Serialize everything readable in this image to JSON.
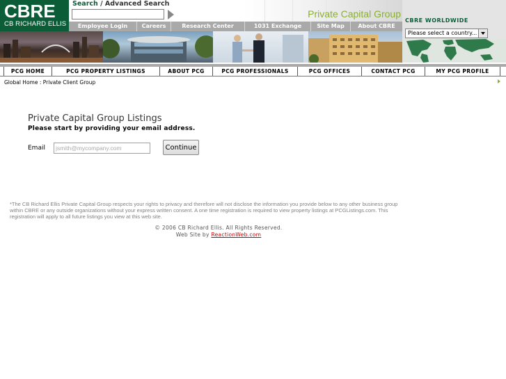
{
  "logo": {
    "main": "CBRE",
    "sub": "CB RICHARD ELLIS"
  },
  "search": {
    "search_label": "Search",
    "separator": "/",
    "advanced_label": "Advanced Search",
    "input_value": "",
    "input_placeholder": ""
  },
  "banner": {
    "title": "Private Capital Group"
  },
  "utility_nav": [
    "Employee Login",
    "Careers",
    "Research Center",
    "1031 Exchange",
    "Site Map",
    "About CBRE"
  ],
  "worldwide": {
    "title": "CBRE WORLDWIDE",
    "select_value": "Please select a country..."
  },
  "main_nav": [
    "PCG HOME",
    "PCG PROPERTY LISTINGS",
    "ABOUT PCG",
    "PCG PROFESSIONALS",
    "PCG OFFICES",
    "CONTACT PCG",
    "MY PCG PROFILE"
  ],
  "breadcrumb": "Global Home : Private Client Group",
  "content": {
    "heading": "Private Capital Group Listings",
    "subheading": "Please start by providing your email address.",
    "email_label": "Email",
    "email_placeholder": "jsmith@mycompany.com",
    "email_value": "",
    "continue_label": "Continue"
  },
  "footer": {
    "privacy": "*The CB Richard Ellis Private Capital Group respects your rights to privacy and therefore will not disclose the information you provide below to any other business group within CBRE or any outside organizations without your express written consent. A one time registration is required to view property listings at PCGListings.com. This registration will apply to all future listings you view at this web site.",
    "copyright": "© 2006 CB Richard Ellis. All Rights Reserved.",
    "credit_prefix": "Web Site by",
    "credit_link": "ReactionWeb.com"
  },
  "colors": {
    "brand_green": "#0b5d38",
    "accent_green": "#8ab02f",
    "nav_gray": "#a9a9a9",
    "link_red": "#cc0000"
  }
}
